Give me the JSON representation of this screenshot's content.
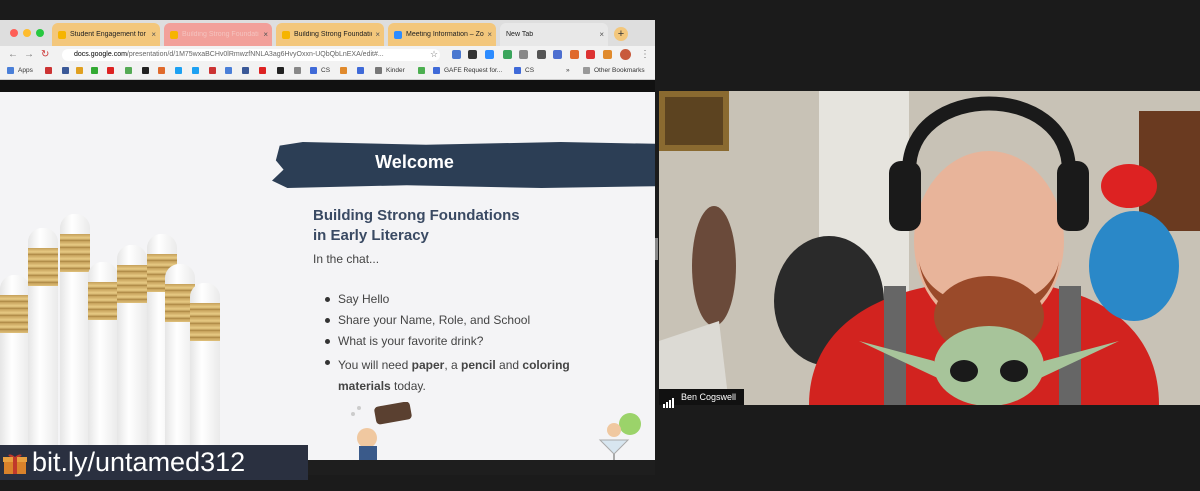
{
  "browser": {
    "tabs": [
      {
        "label": "Student Engagement for L",
        "state": "normal",
        "favicon_color": "#f6b400"
      },
      {
        "label": "Building Strong Foundati",
        "state": "dim",
        "favicon_color": "#f6b400"
      },
      {
        "label": "Building Strong Foundatio",
        "state": "normal",
        "favicon_color": "#f6b400"
      },
      {
        "label": "Meeting Information – Zo",
        "state": "normal",
        "favicon_color": "#2d8cff"
      },
      {
        "label": "New Tab",
        "state": "plain",
        "favicon_color": ""
      }
    ],
    "new_tab_symbol": "+",
    "close_symbol": "×",
    "url_host": "docs.google.com",
    "url_path": "/presentation/d/1M75wxaBCHv0lRmwzfNNLA3ag6HvyOxxn-UQbQbLnEXA/edit#...",
    "bookmarks": [
      {
        "label": "Apps",
        "icon": "apps-grid-icon",
        "color": "#4a7fd8"
      },
      {
        "label": "CS",
        "icon": "cs-bookmark-icon",
        "color": "#3f6ad8"
      },
      {
        "label": "Kinder",
        "icon": "kinder-bookmark-icon",
        "color": "#777777"
      },
      {
        "label": "GAFE Request for...",
        "icon": "gafe-bookmark-icon",
        "color": "#4caf50"
      },
      {
        "label": "CS",
        "icon": "cs-bookmark-icon-2",
        "color": "#3f6ad8"
      }
    ],
    "bookmarks_more": "»",
    "other_bookmarks": "Other Bookmarks"
  },
  "slide": {
    "banner_title": "Welcome",
    "title_line1": "Building Strong Foundations",
    "title_line2": "in Early Literacy",
    "intro": "In the chat...",
    "bullets": [
      "Say Hello",
      "Share your Name, Role, and School",
      "What is your favorite drink?"
    ],
    "bullet4": {
      "part1": "You will need ",
      "paper": "paper",
      "part2": ", a ",
      "pencil": "pencil",
      "part3": " and ",
      "coloring": "coloring",
      "materials": "materials",
      "part4": " today."
    },
    "link": "bit.ly/untamed312",
    "accent_color": "#2c3e55"
  },
  "participant": {
    "name": "Ben Cogswell"
  }
}
